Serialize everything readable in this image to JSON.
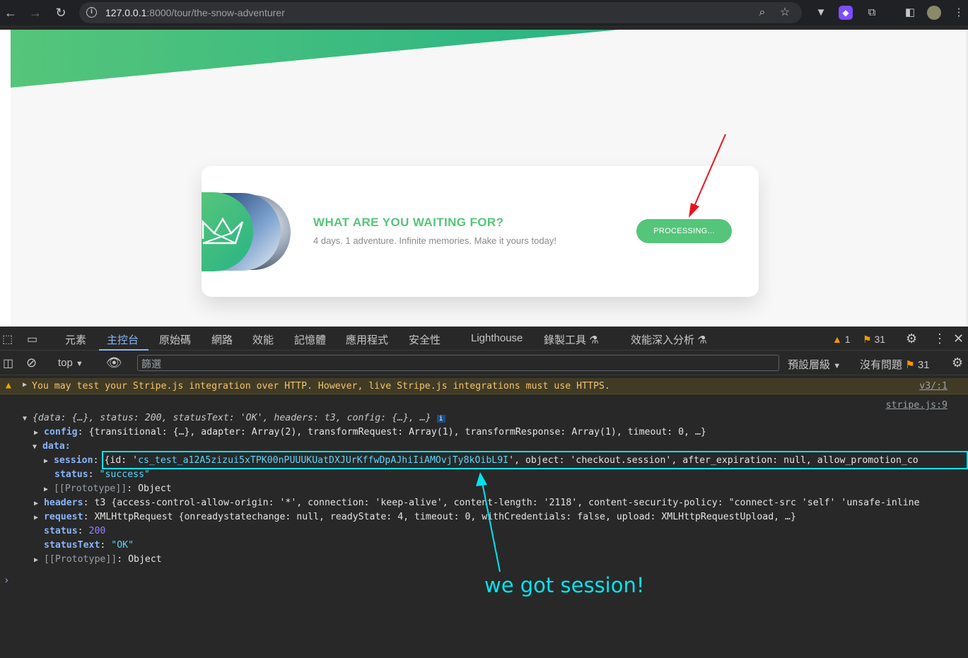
{
  "browser": {
    "url_host": "127.0.0.1",
    "url_path": ":8000/tour/the-snow-adventurer"
  },
  "cta": {
    "title": "WHAT ARE YOU WAITING FOR?",
    "text": "4 days. 1 adventure. Infinite memories. Make it yours today!",
    "button_label": "PROCESSING..."
  },
  "devtools": {
    "tabs": [
      "元素",
      "主控台",
      "原始碼",
      "網路",
      "效能",
      "記憶體",
      "應用程式",
      "安全性",
      "Lighthouse",
      "錄製工具",
      "效能深入分析"
    ],
    "active_tab": "主控台",
    "warn_count": "1",
    "issue_count": "31",
    "context": "top",
    "filter_placeholder": "篩選",
    "levels_label": "預設層級",
    "no_issues_label": "沒有問題",
    "no_issues_count": "31"
  },
  "console": {
    "warning": "You may test your Stripe.js integration over HTTP. However, live Stripe.js integrations must use HTTPS.",
    "warning_source": "v3/:1",
    "log_source": "stripe.js:9",
    "lines": {
      "root": "{data: {…}, status: 200, statusText: 'OK', headers: t3, config: {…}, …}",
      "config": "{transitional: {…}, adapter: Array(2), transformRequest: Array(1), transformResponse: Array(1), timeout: 0, …}",
      "data_label": "data:",
      "session_id": "cs_test_a12A5zizui5xTPK00nPUUUKUatDXJUrKffwDpAJhiIiAMOvjTy8kOibL9I",
      "session_rest": ", object: 'checkout.session', after_expiration: null, allow_promotion_co",
      "status_success": "\"success\"",
      "prototype": "Object",
      "headers": "t3 {access-control-allow-origin: '*', connection: 'keep-alive', content-length: '2118', content-security-policy: \"connect-src 'self' 'unsafe-inline",
      "request": "XMLHttpRequest {onreadystatechange: null, readyState: 4, timeout: 0, withCredentials: false, upload: XMLHttpRequestUpload, …}",
      "status_val": "200",
      "statustext_val": "\"OK\""
    }
  },
  "annotation": {
    "text": "we got session!",
    "arrow_color": "#00e4f0",
    "red_arrow_color": "#e8151b"
  },
  "colors": {
    "brand_green": "#55c57a",
    "devtools_bg": "#282828",
    "accent_blue": "#8ab4f8"
  }
}
